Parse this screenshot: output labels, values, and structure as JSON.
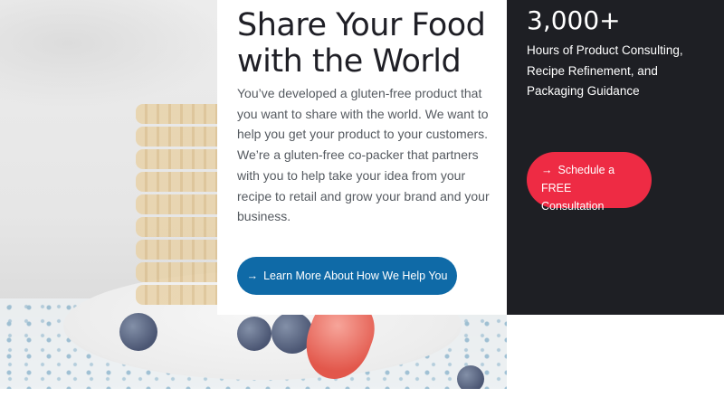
{
  "hero": {
    "headline": "Share Your Food with the World",
    "body": "You’ve developed a gluten-free product that you want to share with the world. We want to help you get your product to your customers. We’re a gluten-free co-packer that partners with you to help take your idea from your recipe to retail and grow your brand and your business.",
    "cta_label": "Learn More About How We Help You",
    "cta_icon": "arrow-right-icon"
  },
  "stats": {
    "value": "3,000+",
    "description": "Hours of Product Consulting, Recipe Refinement, and Packaging Guidance",
    "cta_label_line1": "Schedule a FREE",
    "cta_label_line2": "Consultation",
    "cta_icon": "arrow-right-icon"
  },
  "colors": {
    "primary_blue": "#0f6aa7",
    "accent_red": "#ee2b44",
    "panel_dark": "#1e1f24",
    "heading": "#1f1f26",
    "body_text": "#555a60"
  }
}
